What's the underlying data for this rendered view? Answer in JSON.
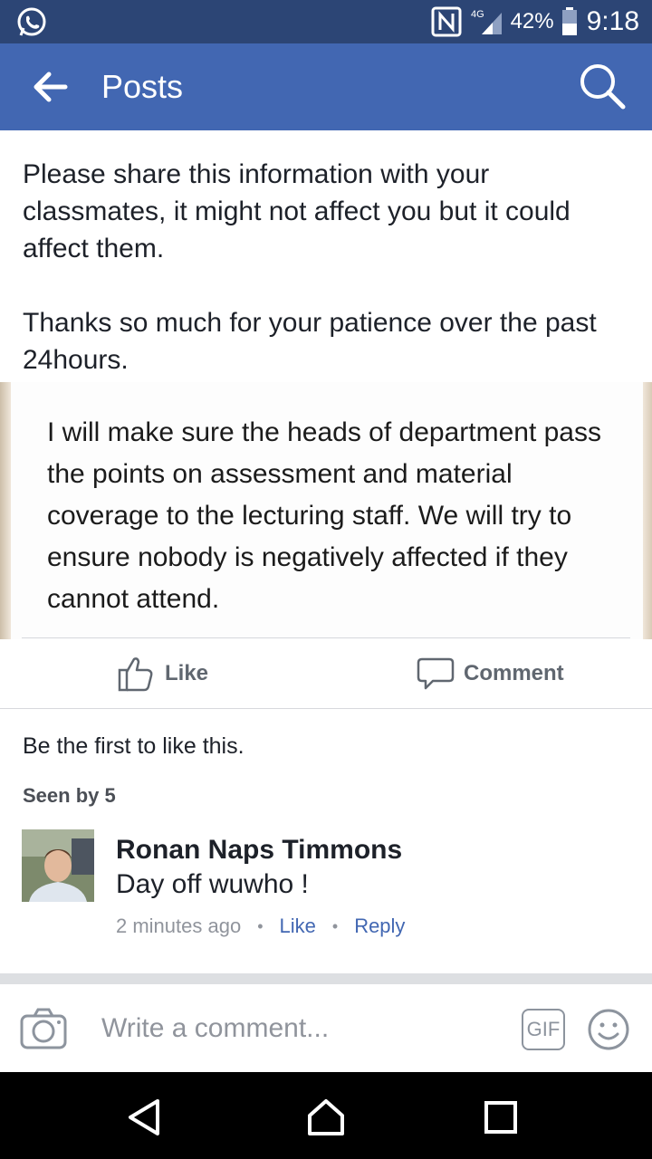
{
  "status_bar": {
    "network": "4G",
    "battery": "42%",
    "time": "9:18",
    "icons": [
      "whatsapp-icon",
      "nfc-icon",
      "signal-icon",
      "battery-icon"
    ]
  },
  "app_bar": {
    "title": "Posts",
    "color": "#4267b2"
  },
  "post": {
    "paragraphs": [
      "Please share this information with your classmates, it might not affect you but it could affect them.",
      "Thanks so much for your patience over the past 24hours."
    ],
    "quoted_image_text": "I will make sure the heads of department pass the points on assessment and material coverage to the lecturing staff. We will try to ensure nobody is negatively affected if they cannot attend."
  },
  "actions": {
    "like": "Like",
    "comment": "Comment"
  },
  "engagement": {
    "likes_text": "Be the first to like this.",
    "seen_by": "Seen by 5"
  },
  "comment": {
    "author": "Ronan Naps Timmons",
    "text": "Day off wuwho !",
    "time": "2 minutes ago",
    "like": "Like",
    "reply": "Reply",
    "separator": "•"
  },
  "composer": {
    "placeholder": "Write a comment...",
    "gif_label": "GIF"
  }
}
